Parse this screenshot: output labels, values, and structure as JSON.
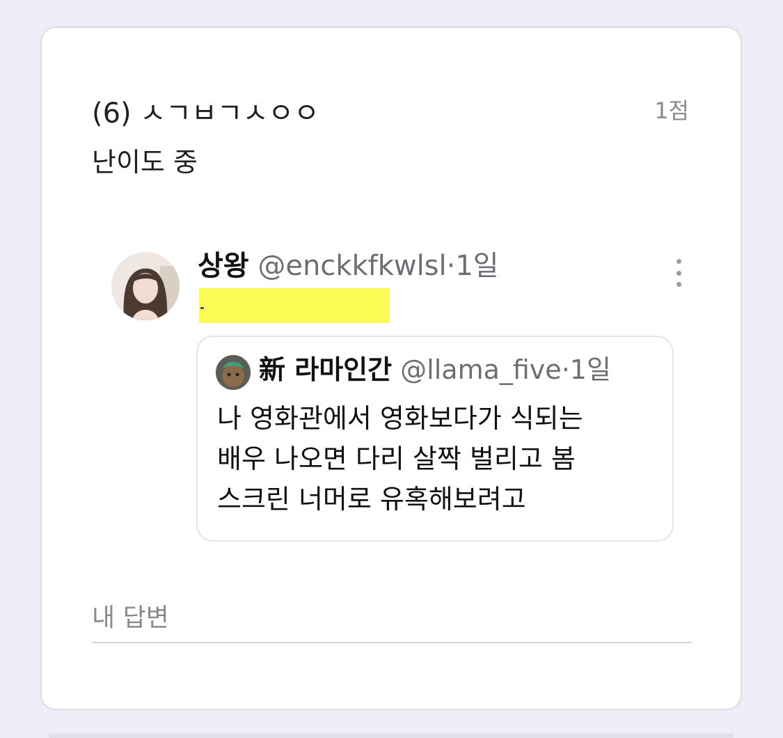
{
  "question": {
    "title": "(6) ㅅㄱㅂㄱㅅㅇㅇ",
    "points": "1점",
    "difficulty": "난이도 중"
  },
  "tweet": {
    "name": "상왕",
    "handle": "@enckkfkwlsl",
    "separator": "·",
    "time": "1일",
    "more_icon": "more-vertical-icon",
    "highlight_color": "#fbfb55",
    "quote": {
      "name": "新 라마인간",
      "handle": "@llama_five",
      "separator": "·",
      "time": "1일",
      "lines": [
        "나 영화관에서 영화보다가 식되는",
        "배우 나오면 다리 살짝 벌리고 봄",
        "스크린 너머로 유혹해보려고"
      ]
    }
  },
  "answer": {
    "label": "내 답변",
    "value": ""
  }
}
